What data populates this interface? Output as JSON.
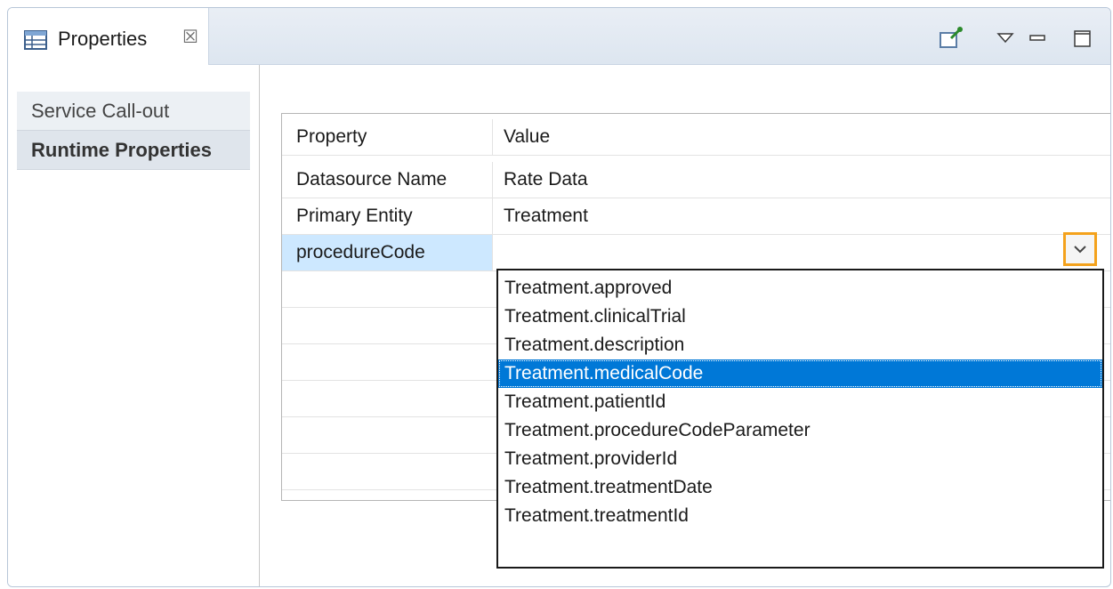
{
  "view": {
    "tab_label": "Properties",
    "tab_close_glyph": "☒"
  },
  "nav": {
    "items": [
      {
        "label": "Service Call-out",
        "selected": false
      },
      {
        "label": "Runtime Properties",
        "selected": true
      }
    ]
  },
  "table": {
    "headers": [
      "Property",
      "Value"
    ],
    "rows": [
      {
        "property": "Datasource Name",
        "value": "Rate Data"
      },
      {
        "property": "Primary Entity",
        "value": "Treatment"
      },
      {
        "property": "procedureCode",
        "value": ""
      }
    ]
  },
  "dropdown": {
    "options": [
      "Treatment.approved",
      "Treatment.clinicalTrial",
      "Treatment.description",
      "Treatment.medicalCode",
      "Treatment.patientId",
      "Treatment.procedureCodeParameter",
      "Treatment.providerId",
      "Treatment.treatmentDate",
      "Treatment.treatmentId"
    ],
    "selected": "Treatment.medicalCode"
  },
  "colors": {
    "accent_highlight": "#f4a21c",
    "selection": "#0078d7",
    "row_selection": "#cde8ff"
  },
  "icons": [
    "table-icon",
    "pin-icon",
    "view-menu-icon",
    "minimize-icon",
    "maximize-icon",
    "chevron-down-icon"
  ]
}
